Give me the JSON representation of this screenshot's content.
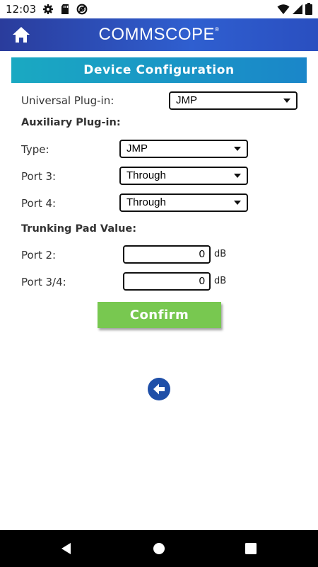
{
  "status_bar": {
    "time": "12:03",
    "icons_left": [
      "gear-icon",
      "sd-card-icon",
      "do-not-disturb-icon"
    ],
    "icons_right": [
      "wifi-icon",
      "signal-icon",
      "battery-icon"
    ]
  },
  "header": {
    "brand": "COMMSCOPE",
    "brand_mark": "®",
    "home_icon": "home-icon",
    "background_colors": [
      "#2a3c9c",
      "#2f5fd0"
    ]
  },
  "page": {
    "title": "Device Configuration",
    "title_colors": [
      "#1aa9c2",
      "#1a86c9"
    ]
  },
  "form": {
    "universal_plugin": {
      "label": "Universal Plug-in:",
      "value": "JMP"
    },
    "auxiliary_heading": "Auxiliary Plug-in:",
    "type": {
      "label": "Type:",
      "value": "JMP"
    },
    "port3": {
      "label": "Port 3:",
      "value": "Through"
    },
    "port4": {
      "label": "Port 4:",
      "value": "Through"
    },
    "trunking_heading": "Trunking Pad Value:",
    "port2_pad": {
      "label": "Port 2:",
      "value": "0",
      "unit": "dB"
    },
    "port34_pad": {
      "label": "Port 3/4:",
      "value": "0",
      "unit": "dB"
    }
  },
  "actions": {
    "confirm_label": "Confirm",
    "confirm_color": "#78c850",
    "back_icon": "back-arrow-icon",
    "back_color": "#1f4fa8"
  },
  "nav_bar": {
    "icons": [
      "nav-back-icon",
      "nav-home-icon",
      "nav-recents-icon"
    ]
  }
}
